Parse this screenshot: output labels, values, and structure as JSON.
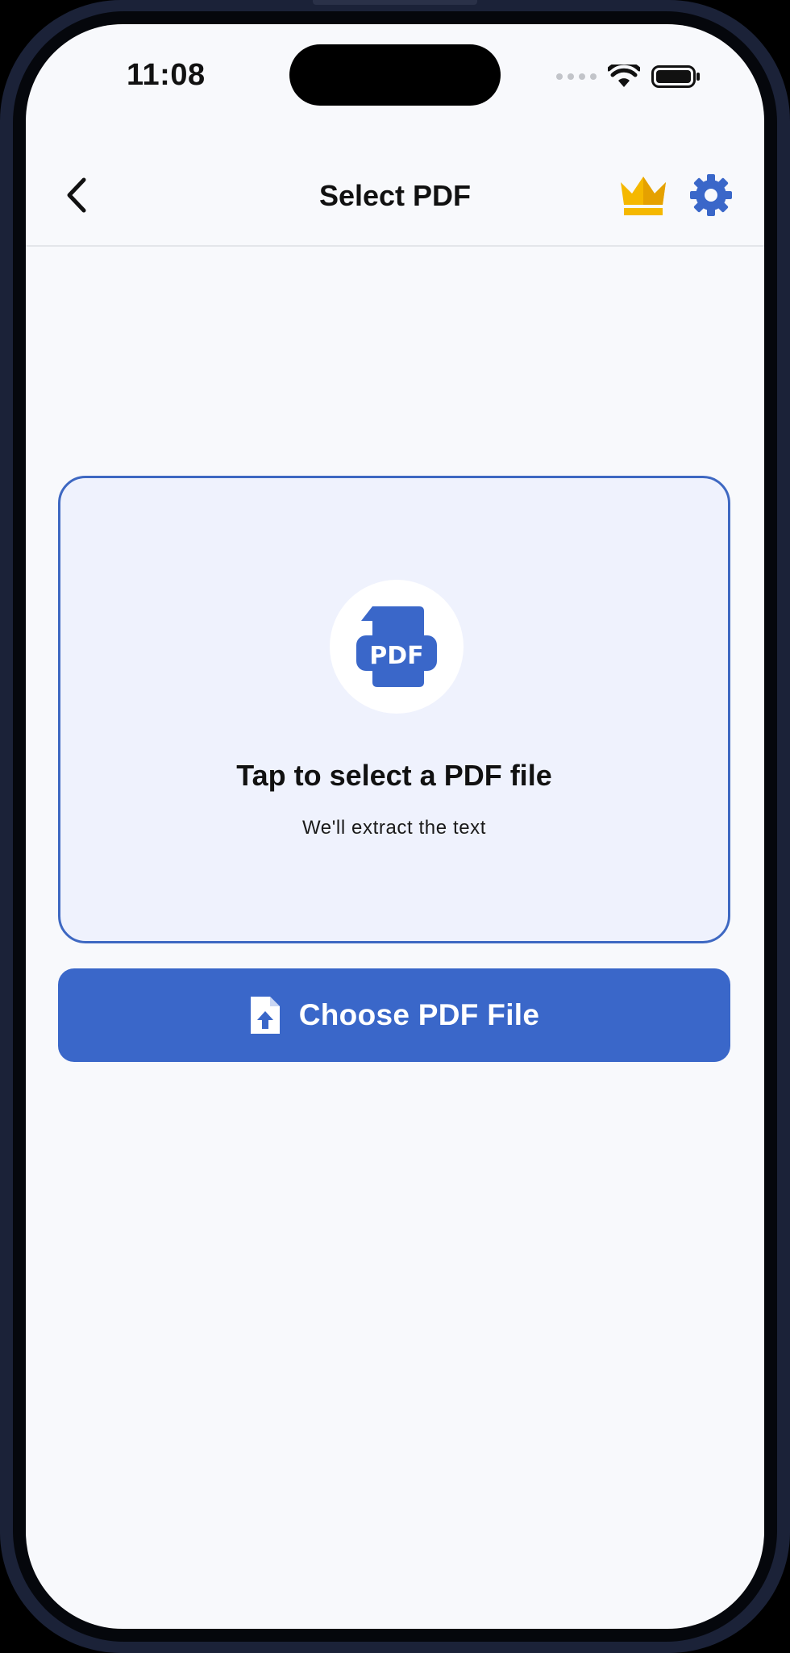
{
  "status_bar": {
    "time": "11:08"
  },
  "nav": {
    "title": "Select PDF",
    "back_icon": "chevron-left-icon",
    "premium_icon": "crown-icon",
    "settings_icon": "gear-icon"
  },
  "drop_zone": {
    "icon": "pdf-file-icon",
    "icon_text": "PDF",
    "title": "Tap to select a PDF file",
    "subtitle": "We'll extract the text"
  },
  "choose_button": {
    "icon": "file-upload-icon",
    "label": "Choose PDF File"
  },
  "colors": {
    "accent": "#3a67c9",
    "crown": "#f5b800",
    "drop_zone_bg": "#eff2fd",
    "screen_bg": "#f8f9fc"
  }
}
